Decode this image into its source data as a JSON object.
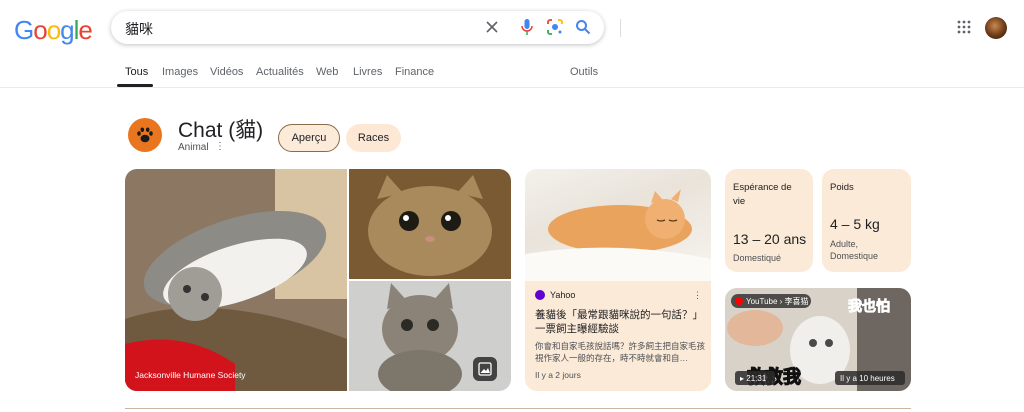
{
  "logo": {
    "letters": [
      "G",
      "o",
      "o",
      "g",
      "l",
      "e"
    ],
    "colors": [
      "#4285F4",
      "#EA4335",
      "#FBBC05",
      "#4285F4",
      "#34A853",
      "#EA4335"
    ]
  },
  "search": {
    "query": "貓咪"
  },
  "tabs": [
    "Tous",
    "Images",
    "Vidéos",
    "Actualités",
    "Web",
    "Livres",
    "Finance",
    "Outils"
  ],
  "knowledge_panel": {
    "title": "Chat (貓)",
    "subtitle": "Animal",
    "chips": [
      "Aperçu",
      "Races"
    ],
    "image_credit": "Jacksonville Humane Society",
    "news": {
      "source": "Yahoo",
      "headline": "養貓後「最常跟貓咪說的一句話？」一票飼主曝經驗談",
      "snippet": "你會和自家毛孩說話嗎？許多飼主把自家毛孩視作家人一般的存在，時不時就會和自…",
      "time": "Il y a 2 jours"
    },
    "facts": [
      {
        "label": "Espérance de vie",
        "value": "13 – 20 ans",
        "note": "Domestiqué"
      },
      {
        "label": "Poids",
        "value": "4 – 5 kg",
        "note": "Adulte, Domestique"
      }
    ],
    "video": {
      "source": "YouTube › 李喜猫",
      "duration": "21:31",
      "time": "Il y a 10 heures",
      "overlay_top": "我也怕",
      "overlay_bottom": "救救我"
    }
  },
  "colors": {
    "accent": "#e9751f",
    "card_bg": "#fbead7",
    "chip_bg": "#fce8d4"
  }
}
